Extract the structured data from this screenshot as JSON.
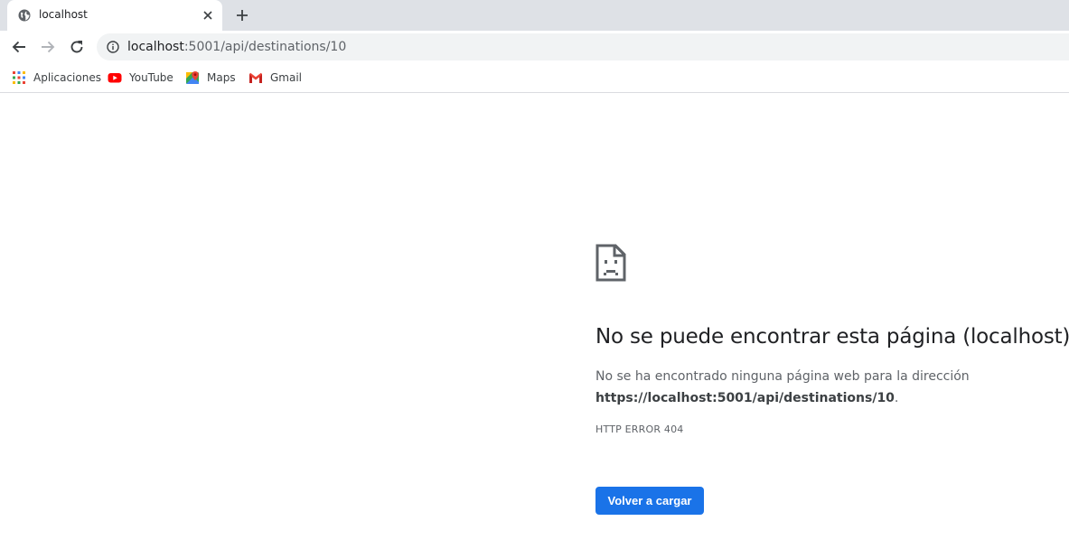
{
  "tab": {
    "title": "localhost",
    "icons": {
      "favicon": "globe-icon",
      "close": "close-icon",
      "new_tab": "plus-icon"
    }
  },
  "toolbar": {
    "url_host": "localhost",
    "url_path": ":5001/api/destinations/10",
    "icons": {
      "back": "arrow-back-icon",
      "forward": "arrow-forward-icon",
      "reload": "reload-icon",
      "site_info": "info-icon"
    }
  },
  "bookmarks": [
    {
      "label": "Aplicaciones",
      "icon": "apps-grid-icon"
    },
    {
      "label": "YouTube",
      "icon": "youtube-icon"
    },
    {
      "label": "Maps",
      "icon": "maps-icon"
    },
    {
      "label": "Gmail",
      "icon": "gmail-icon"
    }
  ],
  "error": {
    "icon": "sad-document-icon",
    "title": "No se puede encontrar esta página (localhost)",
    "description_prefix": "No se ha encontrado ninguna página web para la dirección",
    "description_url": "https://localhost:5001/api/destinations/10",
    "description_suffix": ".",
    "code": "HTTP ERROR 404",
    "reload_label": "Volver a cargar"
  },
  "colors": {
    "accent": "#1a73e8",
    "tabstrip": "#dee1e6",
    "omnibox": "#f1f3f4"
  }
}
